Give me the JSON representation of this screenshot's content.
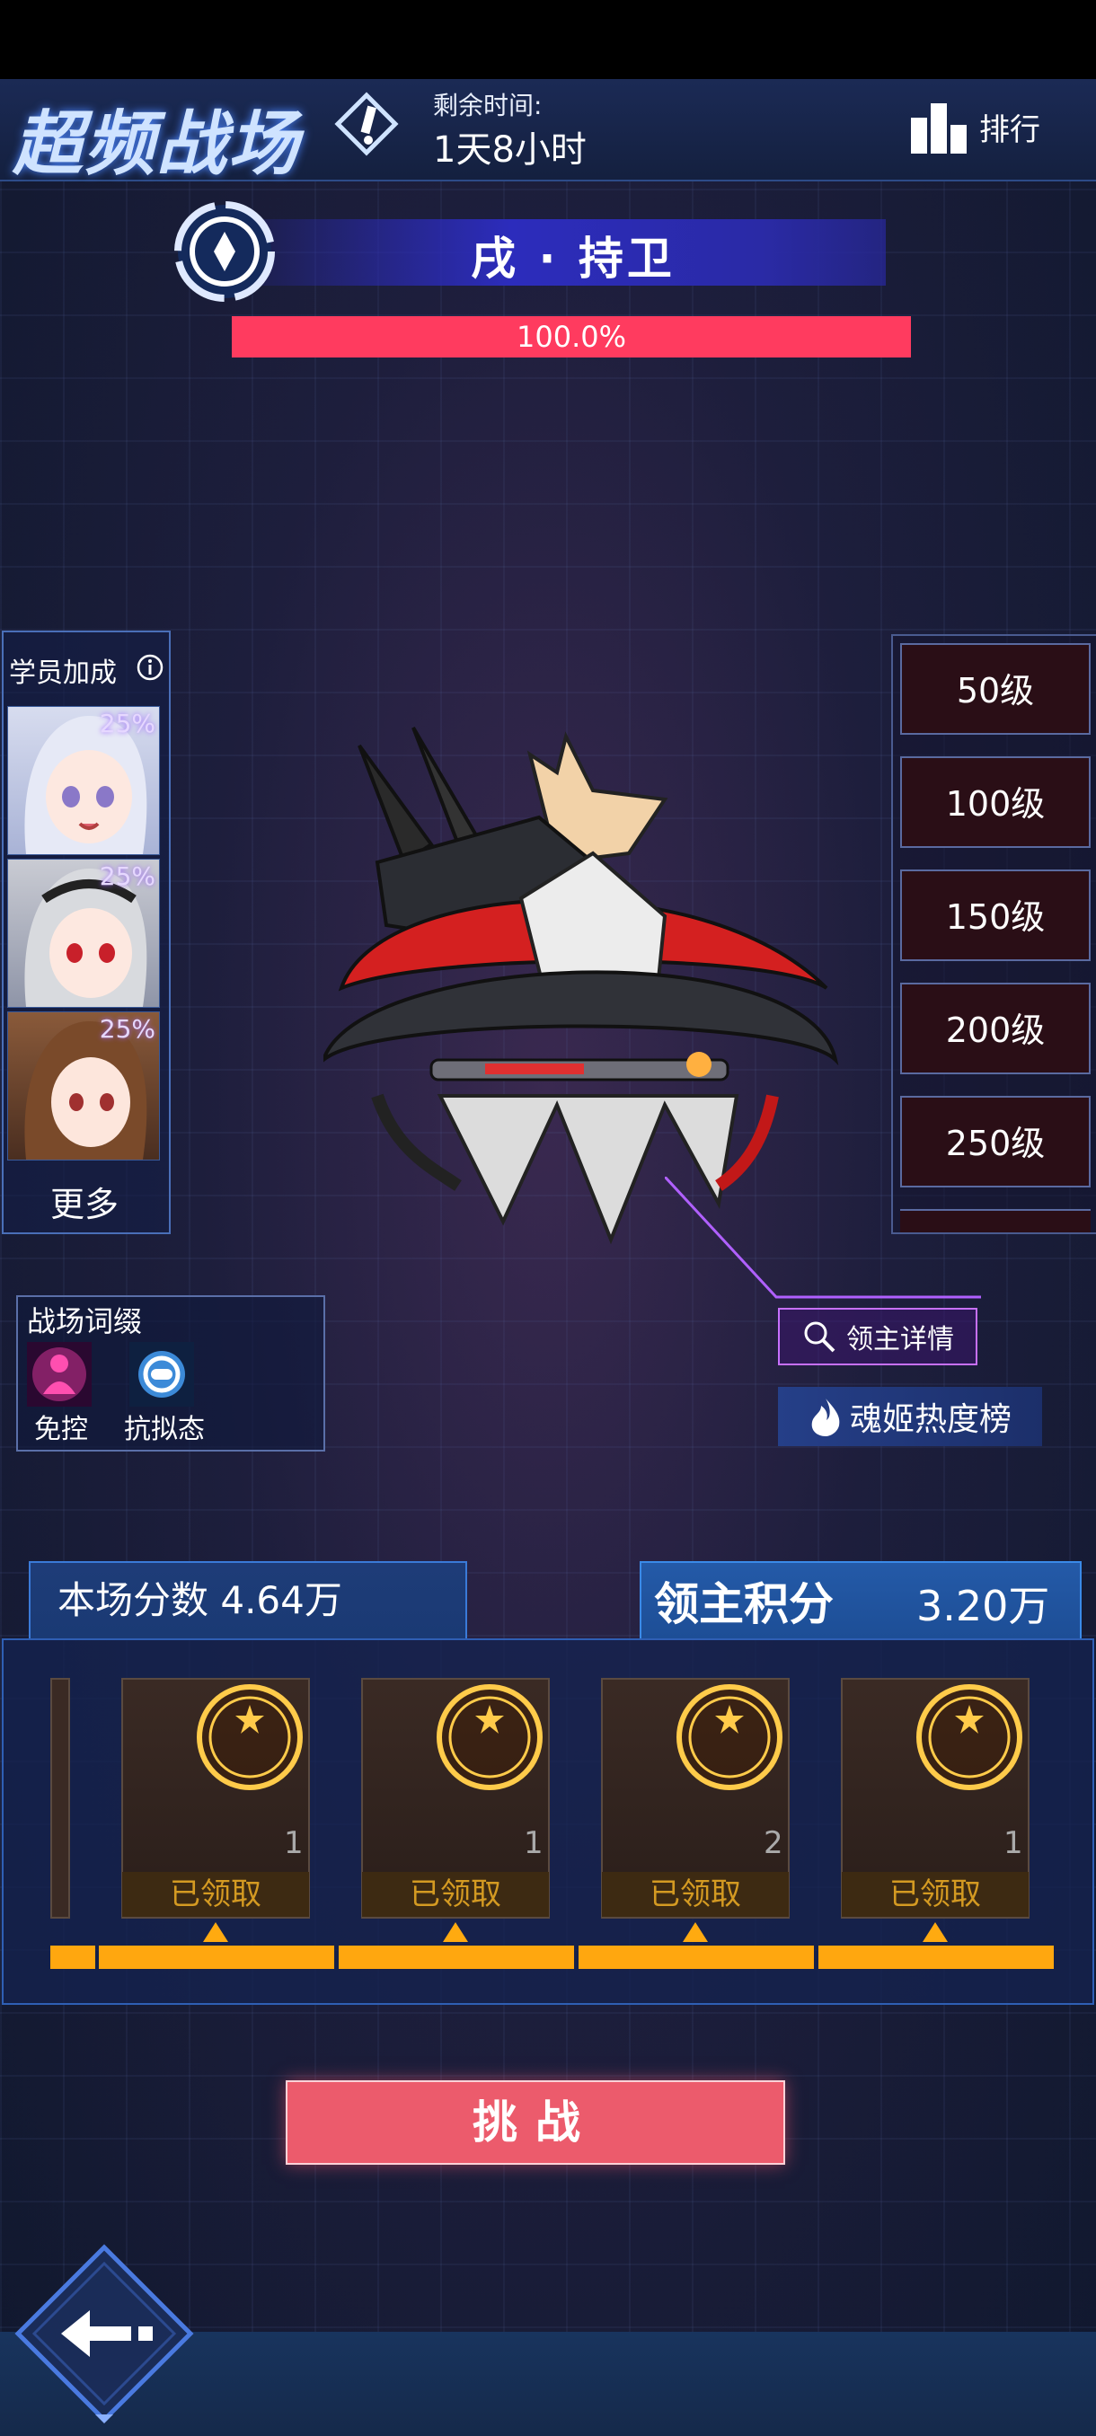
{
  "header": {
    "title": "超频战场",
    "remaining_label": "剩余时间:",
    "remaining_value": "1天8小时",
    "rank_label": "排行"
  },
  "boss": {
    "name": "戌 · 持卫",
    "hp_text": "100.0%",
    "hp_fraction": 1.0
  },
  "bonus": {
    "title": "学员加成",
    "avatars": [
      {
        "percent": "25%"
      },
      {
        "percent": "25%"
      },
      {
        "percent": "25%"
      }
    ],
    "more_label": "更多"
  },
  "levels": [
    "50级",
    "100级",
    "150级",
    "200级",
    "250级"
  ],
  "suffix": {
    "title": "战场词缀",
    "items": [
      {
        "label": "免控",
        "icon": "control-immune-icon"
      },
      {
        "label": "抗拟态",
        "icon": "anti-mimic-icon"
      }
    ]
  },
  "buttons": {
    "lord_detail": "领主详情",
    "heat_rank": "魂姬热度榜",
    "challenge": "挑战"
  },
  "scores": {
    "match_score_label": "本场分数 4.64万",
    "lord_points_label": "领主积分",
    "lord_points_value": "3.20万"
  },
  "rewards": [
    {
      "count": "1",
      "status": "已领取"
    },
    {
      "count": "1",
      "status": "已领取"
    },
    {
      "count": "2",
      "status": "已领取"
    },
    {
      "count": "1",
      "status": "已领取"
    }
  ],
  "colors": {
    "hp_bar": "#ff3b5f",
    "progress": "#ffa70f",
    "challenge": "#ec5b6c"
  }
}
